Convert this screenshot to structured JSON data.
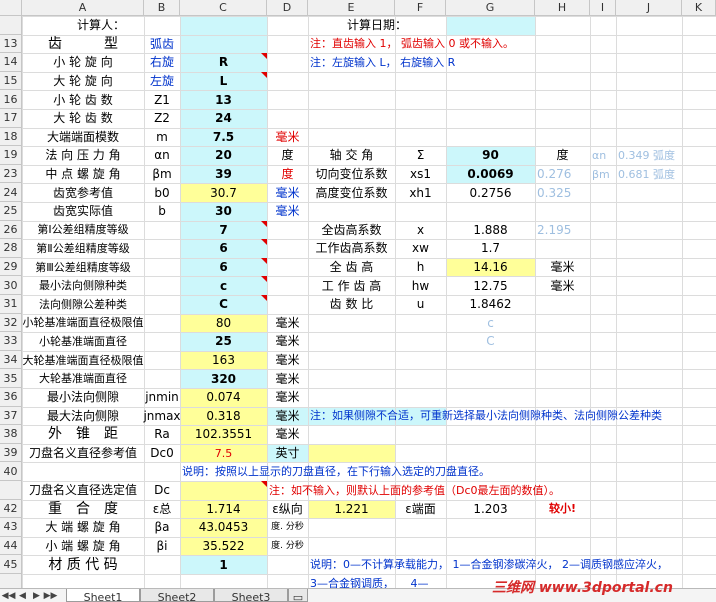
{
  "sheet": {
    "columns": [
      "A",
      "B",
      "C",
      "D",
      "E",
      "F",
      "G",
      "H",
      "I",
      "J",
      "K"
    ],
    "row_numbers": [
      "",
      "13",
      "14",
      "15",
      "16",
      "17",
      "18",
      "19",
      "23",
      "24",
      "25",
      "26",
      "28",
      "29",
      "30",
      "31",
      "32",
      "33",
      "34",
      "35",
      "36",
      "37",
      "38",
      "39",
      "40",
      "",
      "42",
      "43",
      "44",
      "45",
      "",
      "47"
    ],
    "highlight_colors": {
      "cyan": "#ccf7fb",
      "yellow": "#ffff99",
      "red_text": "#e00000",
      "blue_text": "#0033cc",
      "faint_blue": "#9fbfe0"
    },
    "cells": {
      "r0": {
        "a": "计算人：",
        "e": "计算日期："
      },
      "r1": {
        "a": "齿　　　型",
        "b": "弧齿",
        "e": "注：直齿输入 1， 弧齿输入 0 或不输入。"
      },
      "r2": {
        "a": "小 轮 旋 向",
        "b": "右旋",
        "c": "R",
        "e": "注：左旋输入 L， 右旋输入 R"
      },
      "r3": {
        "a": "大 轮 旋 向",
        "b": "左旋",
        "c": "L"
      },
      "r4": {
        "a": "小 轮 齿 数",
        "b": "Z1",
        "c": "13"
      },
      "r5": {
        "a": "大 轮 齿 数",
        "b": "Z2",
        "c": "24"
      },
      "r6": {
        "a": "大端端面模数",
        "b": "m",
        "c": "7.5",
        "d": "毫米"
      },
      "r7": {
        "a": "法 向 压 力 角",
        "b": "αn",
        "c": "20",
        "d": "度",
        "e": "轴 交 角",
        "f": "Σ",
        "g": "90",
        "h": "度",
        "i": "αn",
        "j": "0.349 弧度"
      },
      "r8": {
        "a": "中 点 螺 旋 角",
        "b": "βm",
        "c": "39",
        "d": "度",
        "e": "切向变位系数",
        "f": "xs1",
        "g": "0.0069",
        "h": "0.276",
        "i": "βm",
        "j": "0.681 弧度"
      },
      "r9": {
        "a": "齿宽参考值",
        "b": "b0",
        "c": "30.7",
        "d": "毫米",
        "e": "高度变位系数",
        "f": "xh1",
        "g": "0.2756",
        "h": "0.325"
      },
      "r10": {
        "a": "齿宽实际值",
        "b": "b",
        "c": "30",
        "d": "毫米"
      },
      "r11": {
        "a": "第Ⅰ公差组精度等级",
        "c": "7",
        "e": "全齿高系数",
        "f": "x",
        "g": "1.888",
        "h": "2.195"
      },
      "r12": {
        "a": "第Ⅱ公差组精度等级",
        "c": "6",
        "e": "工作齿高系数",
        "f": "xw",
        "g": "1.7"
      },
      "r13": {
        "a": "第Ⅲ公差组精度等级",
        "c": "6",
        "e": "全 齿 高",
        "f": "h",
        "g": "14.16",
        "h": "毫米"
      },
      "r14": {
        "a": "最小法向侧隙种类",
        "c": "c",
        "e": "工 作 齿 高",
        "f": "hw",
        "g": "12.75",
        "h": "毫米"
      },
      "r15": {
        "a": "法向侧隙公差种类",
        "c": "C",
        "e": "齿 数 比",
        "f": "u",
        "g": "1.8462"
      },
      "r16": {
        "a": "小轮基准端面直径极限值",
        "c": "80",
        "d": "毫米",
        "g": "c"
      },
      "r17": {
        "a": "小轮基准端面直径",
        "c": "25",
        "d": "毫米",
        "g": "C"
      },
      "r18": {
        "a": "大轮基准端面直径极限值",
        "c": "163",
        "d": "毫米"
      },
      "r19": {
        "a": "大轮基准端面直径",
        "c": "320",
        "d": "毫米"
      },
      "r20": {
        "a": "最小法向侧隙",
        "b": "jnmin",
        "c": "0.074",
        "d": "毫米"
      },
      "r21": {
        "a": "最大法向侧隙",
        "b": "jnmax",
        "c": "0.318",
        "d": "毫米",
        "e": "注：如果侧隙不合适，可重新选择最小法向侧隙种类、法向侧隙公差种类"
      },
      "r22": {
        "a": "外　锥　距",
        "b": "Ra",
        "c": "102.3551",
        "d": "毫米"
      },
      "r23": {
        "a": "刀盘名义直径参考值",
        "b": "Dc0",
        "c": "7.5",
        "d": "英寸"
      },
      "r24": {
        "c": "说明：按照以上显示的刀盘直径，在下行输入选定的刀盘直径。"
      },
      "r25": {
        "a": "刀盘名义直径选定值",
        "b": "Dc",
        "d": "注：如不输入，则默认上面的参考值（Dc0最左面的数值）。"
      },
      "r26": {
        "a": "重　合　度",
        "b": "ε总",
        "c": "1.714",
        "d": "ε纵向",
        "e": "1.221",
        "f": "ε端面",
        "g": "1.203",
        "h": "较小!"
      },
      "r27": {
        "a": "大 端 螺 旋 角",
        "b": "βa",
        "c": "43.0453",
        "d": "度. 分秒"
      },
      "r28": {
        "a": "小 端 螺 旋 角",
        "b": "βi",
        "c": "35.522",
        "d": "度. 分秒"
      },
      "r29": {
        "a": "材 质 代 码",
        "c": "1",
        "e": "说明：0—不计算承载能力， 1—合金钢渗碳淬火， 2—调质钢感应淬火，"
      },
      "r30": {
        "e": "3—合金钢调质，　　4—"
      }
    }
  },
  "tabs": [
    "Sheet1",
    "Sheet2",
    "Sheet3"
  ],
  "tab_nav": {
    "first": "◀◀",
    "prev": "◀",
    "next": "▶",
    "last": "▶▶"
  },
  "watermark": "三维网 www.3dportal.cn"
}
